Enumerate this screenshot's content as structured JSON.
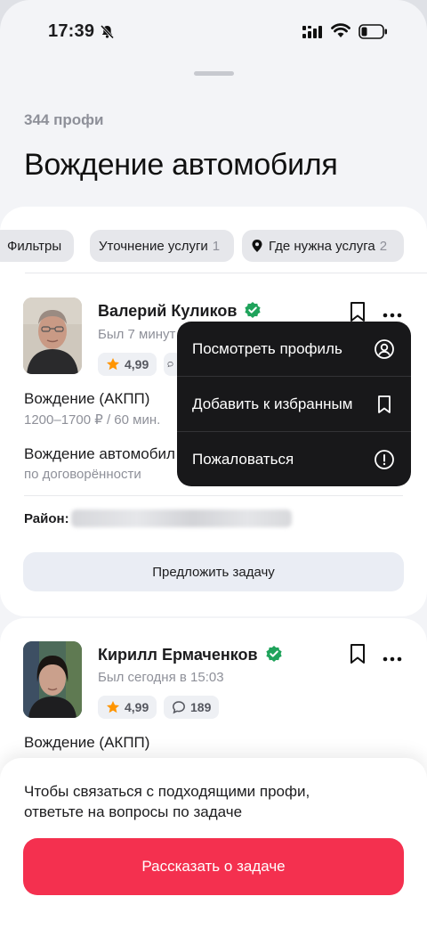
{
  "status_bar": {
    "time": "17:39"
  },
  "header": {
    "count": "344 профи",
    "title": "Вождение автомобиля"
  },
  "filters": {
    "filters_label": "Фильтры",
    "refine_label": "Уточнение услуги",
    "refine_count": "1",
    "location_label": "Где нужна услуга",
    "location_count": "2"
  },
  "cards": [
    {
      "name": "Валерий Куликов",
      "seen": "Был 7 минут",
      "rating": "4,99",
      "services": [
        {
          "title": "Вождение (АКПП)",
          "price": "1200–1700 ₽ / 60 мин."
        },
        {
          "title": "Вождение автомобил",
          "price": "по договорённости"
        }
      ],
      "district_label": "Район:",
      "offer_button": "Предложить задачу"
    },
    {
      "name": "Кирилл Ермаченков",
      "seen": "Был сегодня в 15:03",
      "rating": "4,99",
      "reviews": "189",
      "services": [
        {
          "title": "Вождение (АКПП)"
        }
      ]
    }
  ],
  "context_menu": {
    "items": [
      {
        "label": "Посмотреть профиль",
        "icon": "profile-icon"
      },
      {
        "label": "Добавить к избранным",
        "icon": "bookmark-icon"
      },
      {
        "label": "Пожаловаться",
        "icon": "report-icon"
      }
    ]
  },
  "bottom_sheet": {
    "hint": "Чтобы связаться с подходящими профи, ответьте на вопросы по задаче",
    "cta": "Рассказать о задаче"
  },
  "colors": {
    "accent": "#f4304f",
    "verified": "#1fa35b",
    "star": "#ff9500",
    "menu_bg": "#18181a"
  }
}
